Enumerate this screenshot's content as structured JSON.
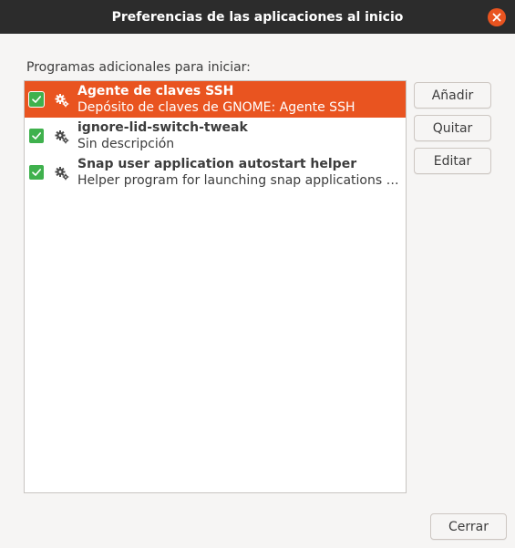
{
  "window": {
    "title": "Preferencias de las aplicaciones al inicio"
  },
  "section_label": "Programas adicionales para iniciar:",
  "programs": [
    {
      "name": "Agente de claves SSH",
      "description": "Depósito de claves de GNOME: Agente SSH",
      "enabled": true,
      "selected": true
    },
    {
      "name": "ignore-lid-switch-tweak",
      "description": "Sin descripción",
      "enabled": true,
      "selected": false
    },
    {
      "name": "Snap user application autostart helper",
      "description": "Helper program for launching snap applications that are configured to start automatically.",
      "enabled": true,
      "selected": false
    }
  ],
  "buttons": {
    "add": "Añadir",
    "remove": "Quitar",
    "edit": "Editar",
    "close": "Cerrar"
  },
  "colors": {
    "accent": "#e95420",
    "check": "#3fb14d",
    "titlebar": "#2c2c2c"
  },
  "icons": {
    "program": "gear-icon",
    "checkbox": "checkmark-icon",
    "window_close": "close-icon"
  }
}
